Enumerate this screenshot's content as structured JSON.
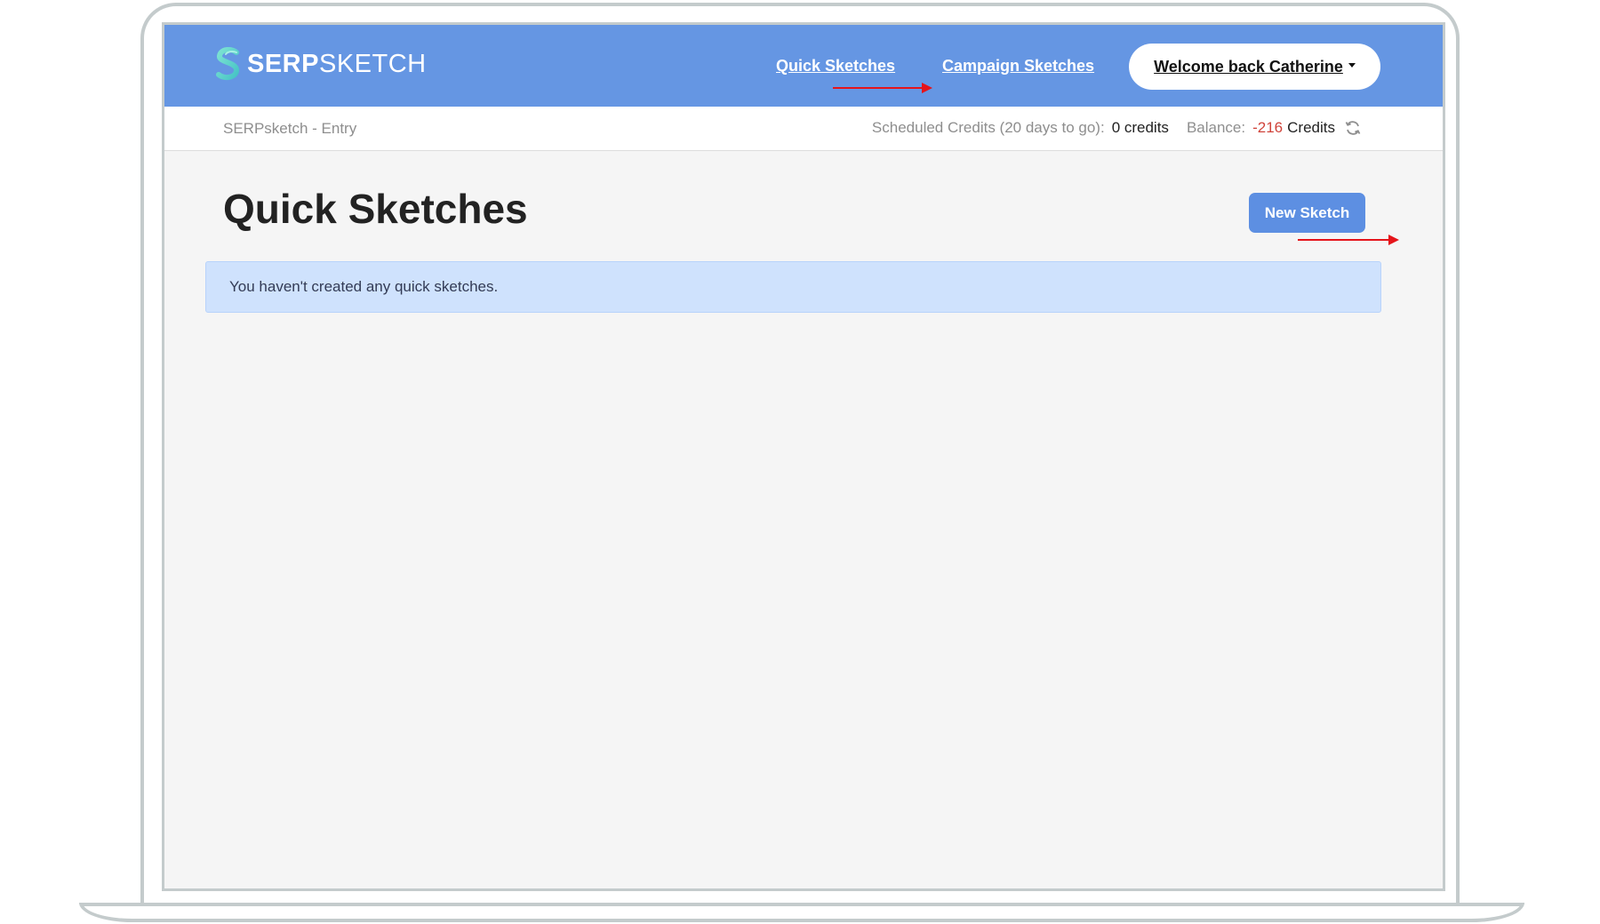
{
  "brand": {
    "name_bold": "SERP",
    "name_light": "SKETCH",
    "logo_icon": "serpsketch-logo-icon"
  },
  "nav": {
    "quick_sketches": "Quick Sketches",
    "campaign_sketches": "Campaign Sketches",
    "user_menu": "Welcome back Catherine"
  },
  "subbar": {
    "account": "SERPsketch - Entry",
    "scheduled_label": "Scheduled Credits (20 days to go):",
    "scheduled_value": "0 credits",
    "balance_label": "Balance:",
    "balance_value": "-216",
    "balance_unit": "Credits",
    "refresh_icon": "refresh-icon"
  },
  "main": {
    "title": "Quick Sketches",
    "new_button": "New Sketch",
    "empty_message": "You haven't created any quick sketches."
  },
  "colors": {
    "topbar": "#6596e3",
    "button": "#5d8fe2",
    "alert_bg": "#cfe2fd",
    "negative": "#d0433a",
    "annotation_arrow": "#e5141a",
    "frame": "#c4cbcc"
  }
}
